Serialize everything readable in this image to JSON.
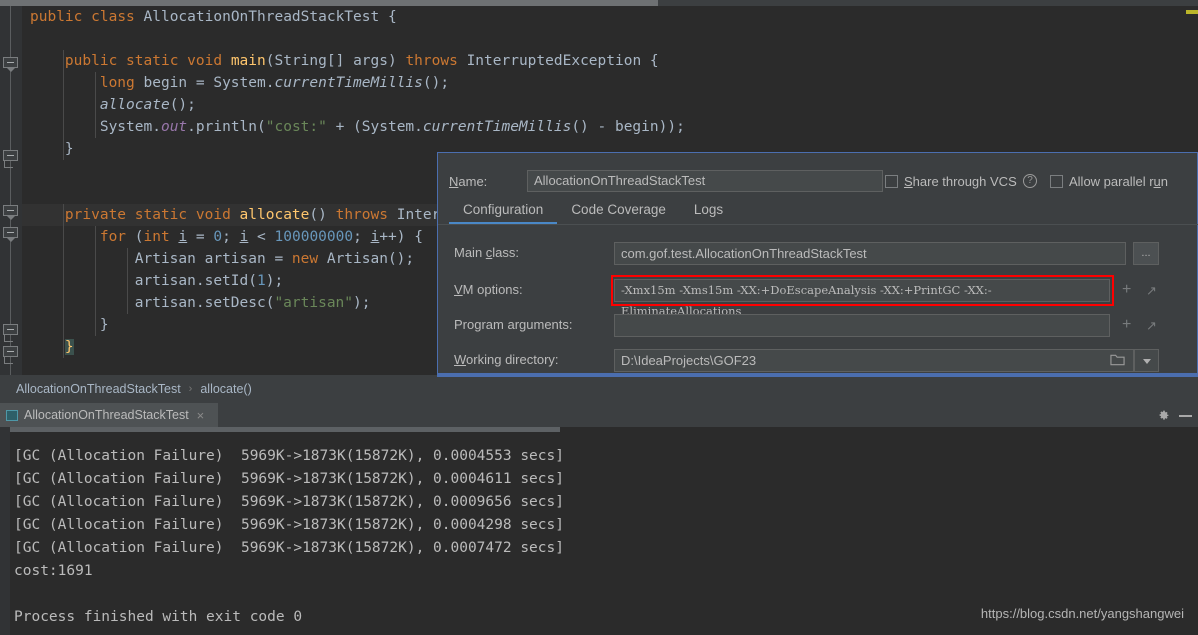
{
  "editor": {
    "lines": [
      "public class AllocationOnThreadStackTest {",
      "",
      "    public static void main(String[] args) throws InterruptedException {",
      "        long begin = System.currentTimeMillis();",
      "        allocate();",
      "        System.out.println(\"cost:\" + (System.currentTimeMillis() - begin));",
      "    }",
      "",
      "",
      "    private static void allocate() throws InterruptedException {",
      "        for (int i = 0; i < 100000000; i++) {",
      "            Artisan artisan = new Artisan();",
      "            artisan.setId(1);",
      "            artisan.setDesc(\"artisan\");",
      "        }",
      "    }",
      "}"
    ],
    "tokens": {
      "kw_public": "public",
      "kw_class": "class",
      "kw_static": "static",
      "kw_void": "void",
      "kw_private": "private",
      "kw_throws": "throws",
      "kw_long": "long",
      "kw_new": "new",
      "kw_for": "for",
      "kw_int": "int",
      "type_name": "AllocationOnThreadStackTest",
      "method_main": "main",
      "method_allocate": "allocate",
      "type_string": "String",
      "type_interrupted": "InterruptedException",
      "var_begin": "begin",
      "cls_system": "System",
      "m_currentTimeMillis": "currentTimeMillis",
      "f_out": "out",
      "m_println": "println",
      "str_cost": "\"cost:\"",
      "num_loop": "100000000",
      "type_artisan": "Artisan",
      "var_artisan": "artisan",
      "m_setId": "setId",
      "m_setDesc": "setDesc",
      "str_artisan": "\"artisan\"",
      "num_one": "1",
      "num_zero": "0",
      "var_i": "i"
    }
  },
  "breadcrumb": {
    "items": [
      "AllocationOnThreadStackTest",
      "allocate()"
    ],
    "separator": "›"
  },
  "run_window": {
    "tab_label": "AllocationOnThreadStackTest",
    "tab_close": "×",
    "gear_icon": "gear-icon",
    "hide_icon": "minimize-icon",
    "console_lines": [
      "[GC (Allocation Failure)  5969K->1873K(15872K), 0.0004553 secs]",
      "[GC (Allocation Failure)  5969K->1873K(15872K), 0.0004611 secs]",
      "[GC (Allocation Failure)  5969K->1873K(15872K), 0.0009656 secs]",
      "[GC (Allocation Failure)  5969K->1873K(15872K), 0.0004298 secs]",
      "[GC (Allocation Failure)  5969K->1873K(15872K), 0.0007472 secs]",
      "cost:1691",
      "",
      "Process finished with exit code 0"
    ],
    "watermark": "https://blog.csdn.net/yangshangwei"
  },
  "dialog": {
    "name_label": "Name:",
    "name_value": "AllocationOnThreadStackTest",
    "share_vcs_label": "Share through VCS",
    "help_icon_glyph": "?",
    "allow_parallel_label": "Allow parallel run",
    "tabs": [
      {
        "label": "Configuration",
        "active": true
      },
      {
        "label": "Code Coverage",
        "active": false
      },
      {
        "label": "Logs",
        "active": false
      }
    ],
    "fields": [
      {
        "label": "Main class:",
        "value": "com.gof.test.AllocationOnThreadStackTest"
      },
      {
        "label": "VM options:",
        "value": "-Xmx15m -Xms15m -XX:+DoEscapeAnalysis -XX:+PrintGC -XX:-EliminateAllocations"
      },
      {
        "label": "Program arguments:",
        "value": ""
      },
      {
        "label": "Working directory:",
        "value": "D:\\IdeaProjects\\GOF23"
      }
    ],
    "browse_button_label": "...",
    "plus_glyph": "+",
    "expand_glyph": "↗",
    "folder_glyph": "὜0",
    "highlight_color": "#ff0000",
    "accent_color": "#4b6eaf"
  }
}
